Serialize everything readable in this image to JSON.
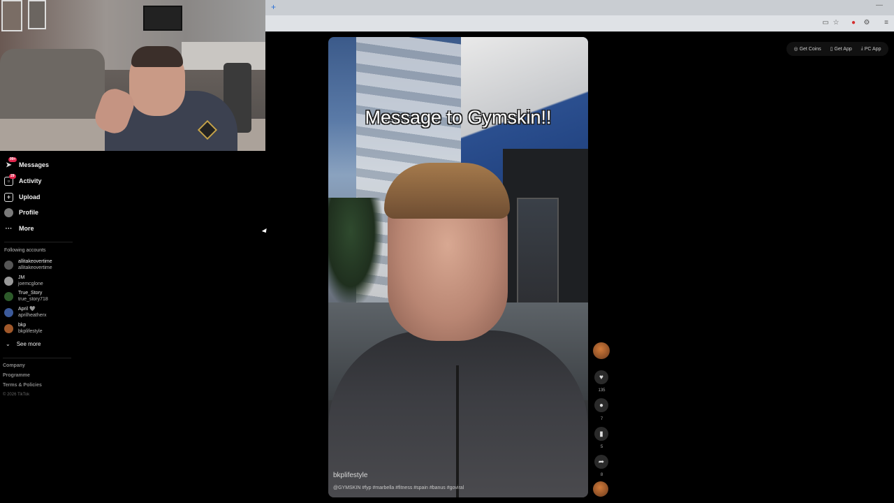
{
  "browser": {
    "new_tab_glyph": "+",
    "minimize_glyph": "—",
    "toolbar_icons": [
      "cast-icon",
      "star-icon",
      "pinterest-icon",
      "extensions-icon",
      "menu-icon"
    ]
  },
  "sidebar": {
    "nav": [
      {
        "label": "Messages",
        "icon": "paper-plane-icon",
        "badge": "99+"
      },
      {
        "label": "Activity",
        "icon": "activity-inbox-icon",
        "badge": "29"
      },
      {
        "label": "Upload",
        "icon": "plus-box-icon"
      },
      {
        "label": "Profile",
        "icon": "avatar"
      },
      {
        "label": "More",
        "icon": "more-dots-icon"
      }
    ],
    "following_title": "Following accounts",
    "accounts": [
      {
        "name": "allitakeovertime",
        "handle": "allitakeovertime"
      },
      {
        "name": "JM",
        "handle": "joemcglone"
      },
      {
        "name": "True_Story",
        "handle": "true_story718"
      },
      {
        "name": "April 🩶",
        "handle": "aprilheatherx"
      },
      {
        "name": "bkp",
        "handle": "bkplifestyle"
      }
    ],
    "see_more": "See more",
    "footer": {
      "company": "Company",
      "programme": "Programme",
      "terms": "Terms & Policies",
      "copyright": "© 2026 TikTok"
    }
  },
  "video": {
    "overlay_title": "Message to Gymskin!!",
    "username": "bkplifestyle",
    "caption": "@GYMSKIN #fyp #marbella #fitness #spain #banus #goviral"
  },
  "actions": {
    "likes": "135",
    "comments": "7",
    "saves": "5",
    "shares": "8"
  },
  "top_links": {
    "coins": "Get Coins",
    "app": "Get App",
    "pc_app": "PC App"
  }
}
